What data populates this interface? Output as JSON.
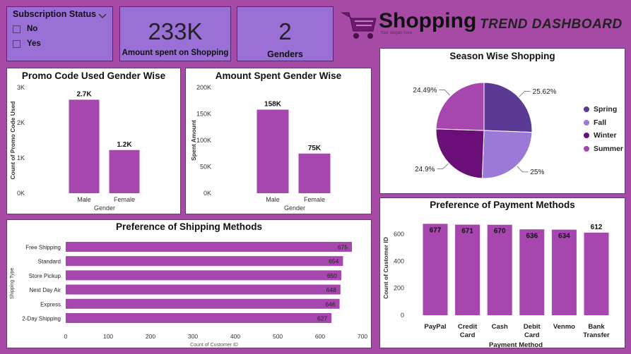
{
  "slicer": {
    "title": "Subscription Status",
    "options": [
      {
        "label": "No"
      },
      {
        "label": "Yes"
      }
    ]
  },
  "kpi_amount": {
    "value": "233K",
    "label": "Amount spent on Shopping"
  },
  "kpi_genders": {
    "value": "2",
    "label": "Genders"
  },
  "brand": {
    "title": "Shopping",
    "subtitle": "TREND DASHBOARD",
    "tagline": "Your slogan here"
  },
  "colors": {
    "bar": "#a646ae",
    "spring": "#5b3a96",
    "fall": "#9c79d8",
    "winter": "#6a0f78",
    "summer": "#a747ad"
  },
  "chart_data": [
    {
      "id": "promo",
      "type": "bar",
      "title": "Promo Code Used Gender Wise",
      "xlabel": "Gender",
      "ylabel": "Count of Promo Code Used",
      "categories": [
        "Male",
        "Female"
      ],
      "values": [
        2652,
        1225
      ],
      "data_labels": [
        "2.7K",
        "1.2K"
      ],
      "yticks": [
        "0K",
        "1K",
        "2K",
        "3K"
      ],
      "ylim": [
        0,
        3000
      ]
    },
    {
      "id": "amount",
      "type": "bar",
      "title": "Amount Spent Gender Wise",
      "xlabel": "Gender",
      "ylabel": "Spent Amount",
      "categories": [
        "Male",
        "Female"
      ],
      "values": [
        158000,
        75000
      ],
      "data_labels": [
        "158K",
        "75K"
      ],
      "yticks": [
        "0K",
        "50K",
        "100K",
        "150K",
        "200K"
      ],
      "ylim": [
        0,
        200000
      ]
    },
    {
      "id": "season",
      "type": "pie",
      "title": "Season Wise Shopping",
      "slices": [
        {
          "name": "Spring",
          "value": 25.62,
          "label": "25.62%"
        },
        {
          "name": "Fall",
          "value": 25.0,
          "label": "25%"
        },
        {
          "name": "Winter",
          "value": 24.9,
          "label": "24.9%"
        },
        {
          "name": "Summer",
          "value": 24.49,
          "label": "24.49%"
        }
      ],
      "legend": "right"
    },
    {
      "id": "shipping",
      "type": "bar",
      "orientation": "horizontal",
      "title": "Preference of Shipping Methods",
      "xlabel": "Count of Customer ID",
      "ylabel": "Shipping Type",
      "categories": [
        "Free Shipping",
        "Standard",
        "Store Pickup",
        "Next Day Air",
        "Express",
        "2-Day Shipping"
      ],
      "values": [
        675,
        654,
        650,
        648,
        646,
        627
      ],
      "xticks": [
        "0",
        "100",
        "200",
        "300",
        "400",
        "500",
        "600",
        "700"
      ],
      "xlim": [
        0,
        700
      ]
    },
    {
      "id": "payment",
      "type": "bar",
      "title": "Preference of Payment Methods",
      "xlabel": "Payment Method",
      "ylabel": "Count of Customer ID",
      "categories": [
        "PayPal",
        "Credit Card",
        "Cash",
        "Debit Card",
        "Venmo",
        "Bank Transfer"
      ],
      "values": [
        677,
        671,
        670,
        636,
        634,
        612
      ],
      "yticks": [
        "0",
        "200",
        "400",
        "600"
      ],
      "ylim": [
        0,
        700
      ]
    }
  ]
}
